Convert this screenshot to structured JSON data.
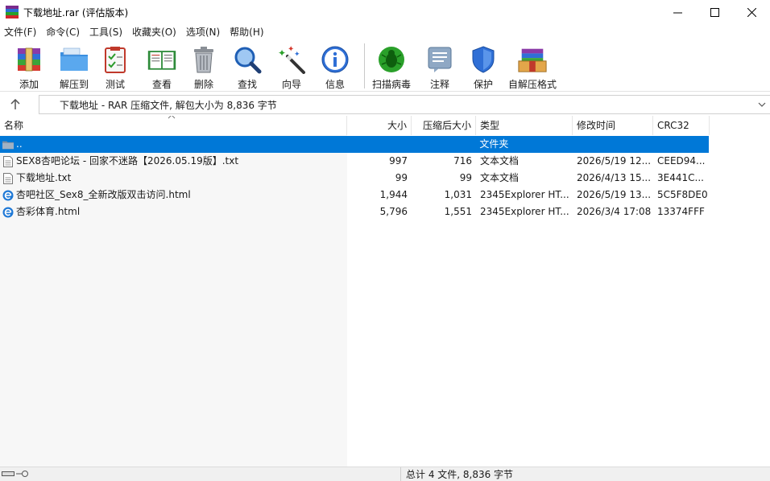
{
  "window": {
    "title": "下载地址.rar (评估版本)"
  },
  "menu": [
    "文件(F)",
    "命令(C)",
    "工具(S)",
    "收藏夹(O)",
    "选项(N)",
    "帮助(H)"
  ],
  "toolbar": {
    "add": "添加",
    "extract_to": "解压到",
    "test": "测试",
    "view": "查看",
    "delete": "删除",
    "find": "查找",
    "wizard": "向导",
    "info": "信息",
    "virus_scan": "扫描病毒",
    "comment": "注释",
    "protect": "保护",
    "sfx": "自解压格式"
  },
  "address": {
    "text": "下载地址 - RAR 压缩文件, 解包大小为 8,836 字节"
  },
  "columns": {
    "name": "名称",
    "size": "大小",
    "packed": "压缩后大小",
    "type": "类型",
    "modified": "修改时间",
    "crc": "CRC32"
  },
  "rows": [
    {
      "name": "..",
      "size": "",
      "packed": "",
      "type": "文件夹",
      "modified": "",
      "crc": "",
      "icon": "folder-icon",
      "selected": true
    },
    {
      "name": "SEX8杏吧论坛 - 回家不迷路【2026.05.19版】.txt",
      "size": "997",
      "packed": "716",
      "type": "文本文档",
      "modified": "2026/5/19 12...",
      "crc": "CEED94...",
      "icon": "text-file-icon"
    },
    {
      "name": "下载地址.txt",
      "size": "99",
      "packed": "99",
      "type": "文本文档",
      "modified": "2026/4/13 15...",
      "crc": "3E441C...",
      "icon": "text-file-icon"
    },
    {
      "name": "杏吧社区_Sex8_全新改版双击访问.html",
      "size": "1,944",
      "packed": "1,031",
      "type": "2345Explorer HT...",
      "modified": "2026/5/19 13...",
      "crc": "5C5F8DE0",
      "icon": "html-file-icon"
    },
    {
      "name": "杏彩体育.html",
      "size": "5,796",
      "packed": "1,551",
      "type": "2345Explorer HT...",
      "modified": "2026/3/4 17:08",
      "crc": "13374FFF",
      "icon": "html-file-icon"
    }
  ],
  "status": {
    "summary": "总计 4 文件, 8,836 字节"
  },
  "colors": {
    "selection": "#0078d7",
    "sorted_column_bg": "#f7f7f7"
  }
}
